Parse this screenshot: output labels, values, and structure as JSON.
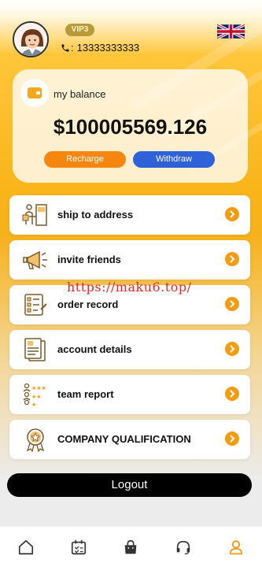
{
  "header": {
    "vip_label": "VIP3",
    "phone_prefix": ":",
    "phone": "13333333333"
  },
  "balance": {
    "label": "my balance",
    "amount": "$100005569.126",
    "recharge_label": "Recharge",
    "withdraw_label": "Withdraw"
  },
  "menu": [
    {
      "label": "ship to address",
      "icon": "delivery-icon"
    },
    {
      "label": "invite friends",
      "icon": "megaphone-icon"
    },
    {
      "label": "order record",
      "icon": "checklist-icon"
    },
    {
      "label": "account details",
      "icon": "documents-icon"
    },
    {
      "label": "team report",
      "icon": "team-rating-icon"
    },
    {
      "label": "COMPANY QUALIFICATION",
      "icon": "award-badge-icon"
    }
  ],
  "watermark": "https://maku6.top/",
  "logout_label": "Logout",
  "nav": [
    {
      "name": "home",
      "icon": "home-icon",
      "active": false
    },
    {
      "name": "orders",
      "icon": "calendar-check-icon",
      "active": false
    },
    {
      "name": "shop",
      "icon": "shopping-bag-icon",
      "active": false
    },
    {
      "name": "service",
      "icon": "headset-icon",
      "active": false
    },
    {
      "name": "profile",
      "icon": "user-icon",
      "active": true
    }
  ],
  "colors": {
    "accent": "#f39c12",
    "recharge": "#f6860e",
    "withdraw": "#2f61d9",
    "nav_active": "#f39c12",
    "nav_inactive": "#333333"
  }
}
